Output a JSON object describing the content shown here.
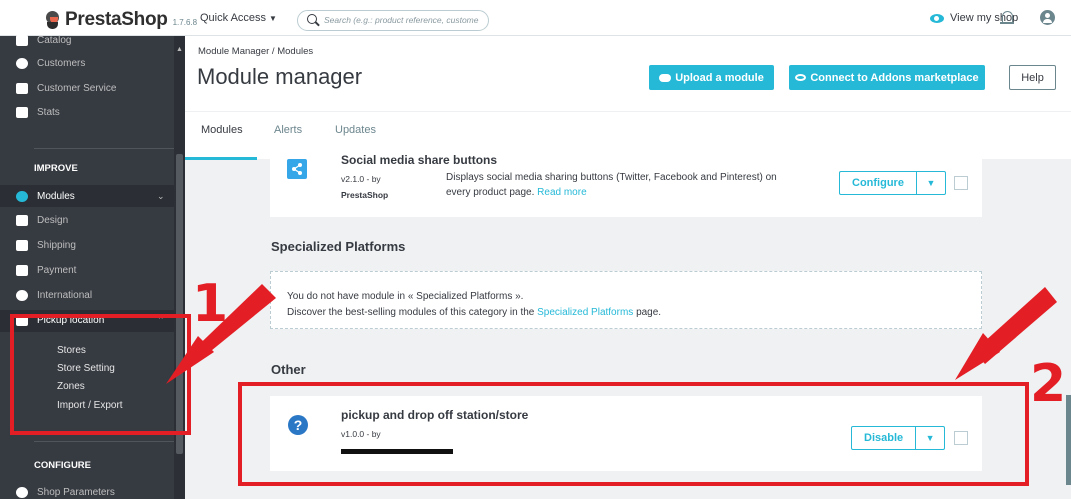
{
  "topbar": {
    "brand": "PrestaShop",
    "version": "1.7.6.8",
    "quick_access": "Quick Access",
    "search_placeholder": "Search (e.g.: product reference, custome",
    "view_shop": "View my shop"
  },
  "sidebar": {
    "items_top": [
      {
        "label": "Catalog",
        "icon": "catalog-icon"
      },
      {
        "label": "Customers",
        "icon": "customer-icon"
      },
      {
        "label": "Customer Service",
        "icon": "chat-icon"
      },
      {
        "label": "Stats",
        "icon": "stats-icon"
      }
    ],
    "improve_heading": "IMPROVE",
    "improve_items": [
      {
        "label": "Modules",
        "icon": "puzzle-icon"
      },
      {
        "label": "Design",
        "icon": "monitor-icon"
      },
      {
        "label": "Shipping",
        "icon": "truck-icon"
      },
      {
        "label": "Payment",
        "icon": "card-icon"
      },
      {
        "label": "International",
        "icon": "globe-icon"
      },
      {
        "label": "Pickup location",
        "icon": "truck-icon"
      }
    ],
    "pickup_subitems": [
      "Stores",
      "Store Setting",
      "Zones",
      "Import / Export"
    ],
    "configure_heading": "CONFIGURE",
    "configure_items": [
      {
        "label": "Shop Parameters",
        "icon": "gear-icon"
      }
    ]
  },
  "header": {
    "breadcrumb": "Module Manager / Modules",
    "title": "Module manager",
    "upload_button": "Upload a module",
    "connect_button": "Connect to Addons marketplace",
    "help_button": "Help",
    "tabs": [
      "Modules",
      "Alerts",
      "Updates"
    ]
  },
  "modules": {
    "social": {
      "name": "Social media share buttons",
      "version": "v2.1.0 - by",
      "author": "PrestaShop",
      "description": "Displays social media sharing buttons (Twitter, Facebook and Pinterest) on every product page.",
      "read_more": "Read more",
      "action": "Configure"
    },
    "specialized": {
      "title": "Specialized Platforms",
      "empty_line1": "You do not have module in « Specialized Platforms ».",
      "empty_line2_pre": "Discover the best-selling modules of this category in the",
      "empty_line2_link": "Specialized Platforms",
      "empty_line2_post": "page."
    },
    "other": {
      "title": "Other",
      "name": "pickup and drop off station/store",
      "version": "v1.0.0 - by",
      "action": "Disable"
    }
  },
  "annotations": {
    "label_1": "1",
    "label_2": "2",
    "color": "#e31e24"
  },
  "colors": {
    "accent": "#25b9d7",
    "sidebar": "#363a41",
    "background": "#eff1f2"
  }
}
